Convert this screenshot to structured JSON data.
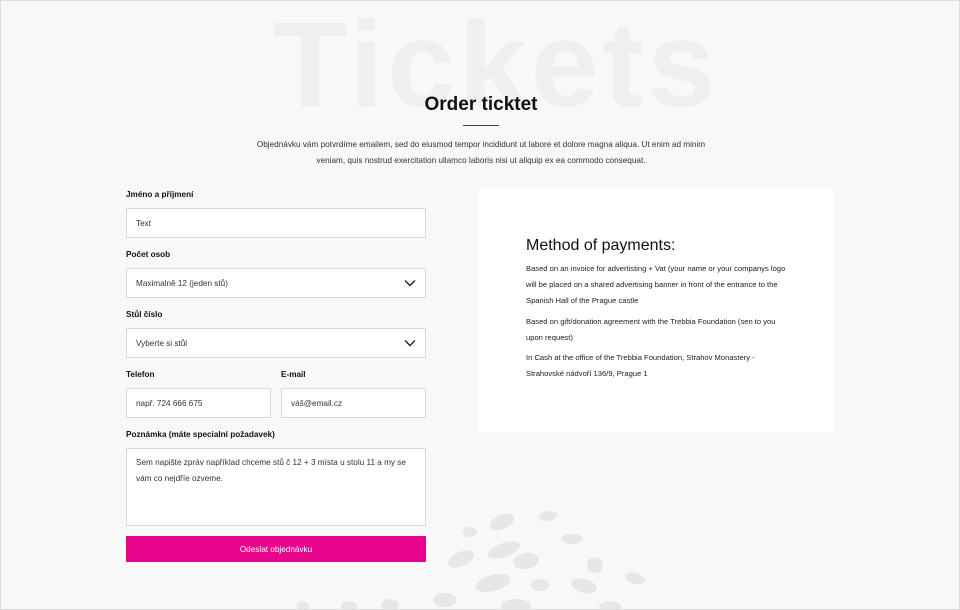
{
  "page": {
    "background_word": "Tickets",
    "title": "Order ticktet",
    "intro_line1": "Objednávku vám potvrdíme emailem, sed do eiusmod tempor incididunt ut labore et dolore magna aliqua. Ut enim ad minim",
    "intro_line2": "veniam, quis nostrud exercitation ullamco laboris nisi ut aliquip ex ea commodo consequat."
  },
  "form": {
    "name_label": "Jméno a příjmení",
    "name_value": "Text",
    "persons_label": "Počet osob",
    "persons_value": "Maximalně 12 (jeden stů)",
    "table_label": "Stůl číslo",
    "table_value": "Vyberte si stůl",
    "phone_label": "Telefon",
    "phone_placeholder": "např. 724 666 675",
    "email_label": "E-mail",
    "email_placeholder": "váš@email.cz",
    "note_label": "Poznámka (máte specialní požadavek)",
    "note_value": "Sem napište zpráv například chceme stů č 12 + 3 místa u stolu 11 a my se vám co nejdříe ozveme.",
    "submit_label": "Odeslat objednávku"
  },
  "payments": {
    "title": "Method of payments:",
    "item1": "Based on an invoice for advertisting + Vat (your name or your companys logo will be placed on a shared advertising banner in front of the entrance to the Spanish Hall of the Prague castle",
    "item2": "Based on gift/donation agreement with the Trebbia Foundation (sen to you upon request)",
    "item3": "In Cash at the office of the Trebbia Foundation, Strahov Monastery - Strahovské nádvoří 136/9, Prague 1"
  },
  "colors": {
    "accent": "#e6058a",
    "background": "#f8f8f8",
    "card": "#ffffff"
  },
  "icons": {
    "select_arrow": "chevron-down-icon"
  }
}
